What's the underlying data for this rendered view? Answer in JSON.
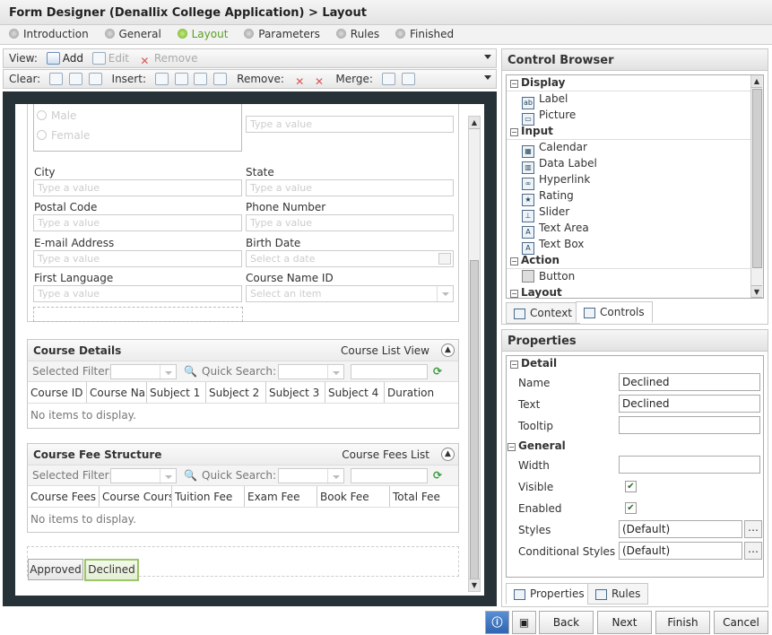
{
  "title": "Form Designer (Denallix College Application) > Layout",
  "steps": [
    "Introduction",
    "General",
    "Layout",
    "Parameters",
    "Rules",
    "Finished"
  ],
  "active_step": "Layout",
  "toolbar1": {
    "view_label": "View:",
    "add": "Add",
    "edit": "Edit",
    "remove": "Remove"
  },
  "toolbar2": {
    "clear": "Clear:",
    "insert": "Insert:",
    "remove": "Remove:",
    "merge": "Merge:"
  },
  "form": {
    "radio_male": "Male",
    "radio_female": "Female",
    "fields": [
      {
        "label": "City",
        "placeholder": "Type a value"
      },
      {
        "label": "State",
        "placeholder": "Type a value"
      },
      {
        "label": "Postal Code",
        "placeholder": "Type a value"
      },
      {
        "label": "Phone Number",
        "placeholder": "Type a value"
      },
      {
        "label": "E-mail Address",
        "placeholder": "Type a value"
      },
      {
        "label": "Birth Date",
        "placeholder": "Select a date"
      },
      {
        "label": "First Language",
        "placeholder": "Type a value"
      },
      {
        "label": "Course Name ID",
        "placeholder": "Select an item"
      }
    ],
    "top_placeholder": "Type a value"
  },
  "sections": [
    {
      "title": "Course Details",
      "view": "Course List View",
      "selected_filter": "Selected Filter:",
      "quick_search": "Quick Search:",
      "columns": [
        "Course ID",
        "Course Nam",
        "Subject 1",
        "Subject 2",
        "Subject 3",
        "Subject 4",
        "Duration"
      ],
      "empty": "No items to display."
    },
    {
      "title": "Course Fee Structure",
      "view": "Course Fees List",
      "selected_filter": "Selected Filter:",
      "quick_search": "Quick Search:",
      "columns": [
        "Course Fees I",
        "Course Course",
        "Tuition Fee",
        "Exam Fee",
        "Book Fee",
        "Total Fee"
      ],
      "empty": "No items to display."
    }
  ],
  "form_buttons": [
    "Approved",
    "Declined"
  ],
  "control_browser": {
    "title": "Control Browser",
    "categories": [
      {
        "name": "Display",
        "items": [
          "Label",
          "Picture"
        ]
      },
      {
        "name": "Input",
        "items": [
          "Calendar",
          "Data Label",
          "Hyperlink",
          "Rating",
          "Slider",
          "Text Area",
          "Text Box"
        ]
      },
      {
        "name": "Action",
        "items": [
          "Button"
        ]
      },
      {
        "name": "Layout",
        "items": []
      }
    ],
    "tabs": [
      "Context",
      "Controls"
    ]
  },
  "properties": {
    "title": "Properties",
    "detail_header": "Detail",
    "general_header": "General",
    "rows": {
      "name": "Name",
      "name_value": "Declined",
      "text": "Text",
      "text_value": "Declined",
      "tooltip": "Tooltip",
      "tooltip_value": "",
      "width": "Width",
      "width_value": "",
      "visible": "Visible",
      "enabled": "Enabled",
      "styles": "Styles",
      "styles_value": "(Default)",
      "cond_styles": "Conditional Styles",
      "cond_styles_value": "(Default)"
    },
    "tabs": [
      "Properties",
      "Rules"
    ]
  },
  "footer": {
    "back": "Back",
    "next": "Next",
    "finish": "Finish",
    "cancel": "Cancel"
  }
}
